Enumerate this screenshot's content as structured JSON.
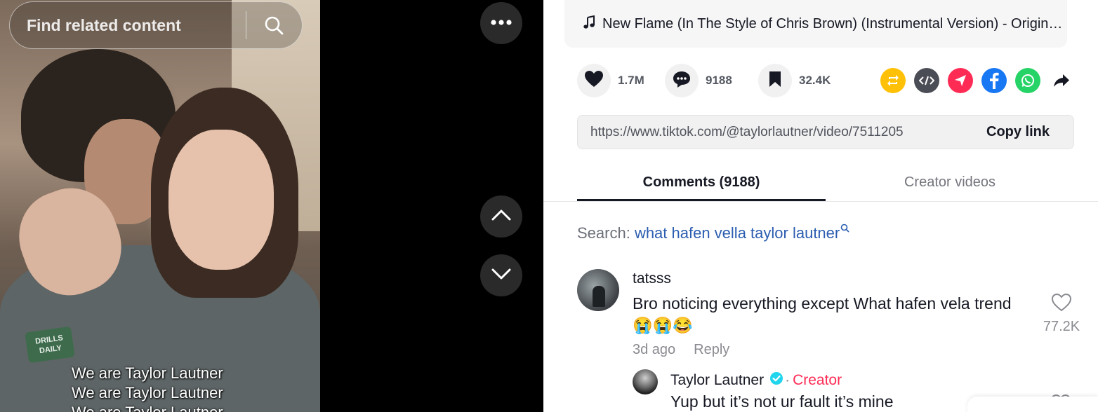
{
  "video": {
    "search_placeholder": "Find related content",
    "patch_text": "DRILLS DAILY",
    "captions": [
      "We are Taylor Lautner",
      "We are Taylor Lautner",
      "We are Taylor Lautner"
    ]
  },
  "controls": {
    "more": "more-icon",
    "prev": "chevron-up-icon",
    "next": "chevron-down-icon"
  },
  "music": {
    "icon": "music-note-icon",
    "title": "New Flame (In The Style of Chris Brown) (Instrumental Version) - Original Karaoke"
  },
  "stats": {
    "likes": "1.7M",
    "comments": "9188",
    "saves": "32.4K"
  },
  "share": {
    "icons": [
      "repost-icon",
      "embed-icon",
      "send-icon",
      "facebook-icon",
      "whatsapp-icon",
      "share-arrow-icon"
    ],
    "colors": {
      "repost": "#ffc107",
      "embed": "#4a4d55",
      "send": "#fe2c55",
      "facebook": "#1877f2",
      "whatsapp": "#25d366"
    }
  },
  "link": {
    "url": "https://www.tiktok.com/@taylorlautner/video/7511205",
    "copy_label": "Copy link"
  },
  "tabs": {
    "comments": "Comments (9188)",
    "creator_videos": "Creator videos"
  },
  "related_search": {
    "prefix": "Search: ",
    "query": "what hafen vella taylor lautner"
  },
  "comments": [
    {
      "user": "tatsss",
      "text": "Bro noticing everything except What hafen vela trend 😭😭😂",
      "time": "3d ago",
      "reply_label": "Reply",
      "likes": "77.2K"
    }
  ],
  "reply": {
    "user": "Taylor Lautner",
    "separator": "·",
    "role": "Creator",
    "text": "Yup but it’s not ur fault it’s mine"
  },
  "accent_colors": {
    "text": "#161823",
    "muted": "#8a8b91",
    "link": "#2b5db0",
    "creator": "#fe2c55",
    "verified": "#20d5ec"
  }
}
